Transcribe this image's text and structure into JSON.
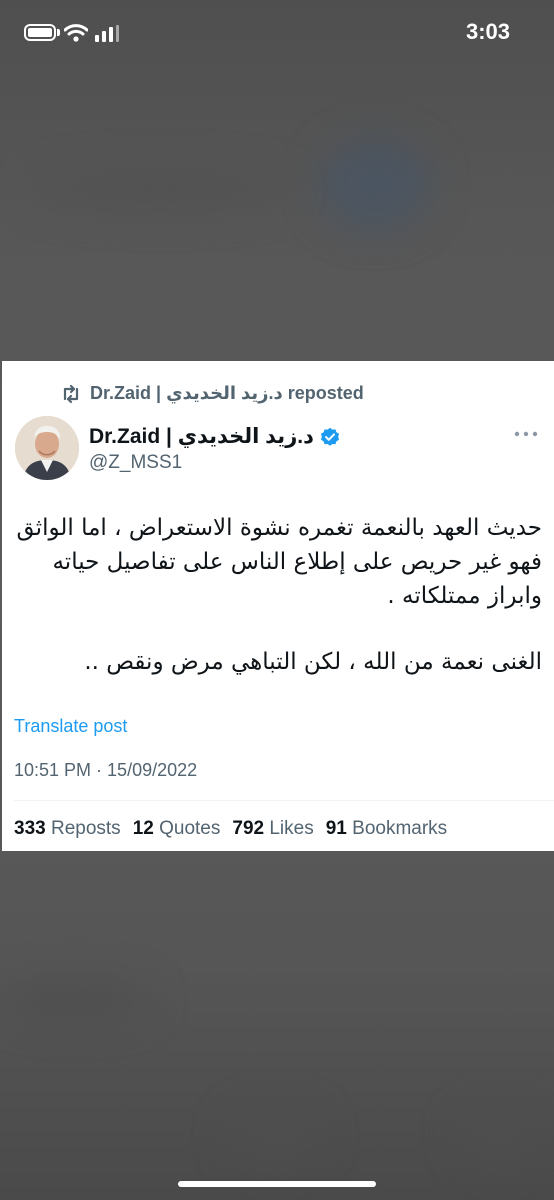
{
  "status_bar": {
    "time": "3:03"
  },
  "tweet": {
    "repost_text": "Dr.Zaid | د.زيد الخديدي reposted",
    "author_name": "Dr.Zaid | د.زيد الخديدي",
    "handle": "@Z_MSS1",
    "body_lines": [
      "حديث العهد بالنعمة تغمره نشوة الاستعراض ، اما الواثق فهو غير حريص على إطلاع الناس على تفاصيل حياته وابراز ممتلكاته .",
      "الغنى نعمة من الله ، لكن التباهي مرض ونقص .."
    ],
    "translate_label": "Translate post",
    "timestamp": "10:51 PM · 15/09/2022",
    "stats": [
      {
        "count": "333",
        "label": "Reposts"
      },
      {
        "count": "12",
        "label": "Quotes"
      },
      {
        "count": "792",
        "label": "Likes"
      },
      {
        "count": "91",
        "label": "Bookmarks"
      }
    ]
  },
  "icons": {
    "repost": "repost-icon",
    "verified": "verified-badge-icon",
    "more": "more-options-icon",
    "battery": "battery-icon",
    "wifi": "wifi-icon",
    "signal": "cellular-signal-icon"
  },
  "colors": {
    "accent": "#1d9bf0",
    "secondary_text": "#536471",
    "primary_text": "#0f1419",
    "backdrop": "#5a5a5a"
  }
}
